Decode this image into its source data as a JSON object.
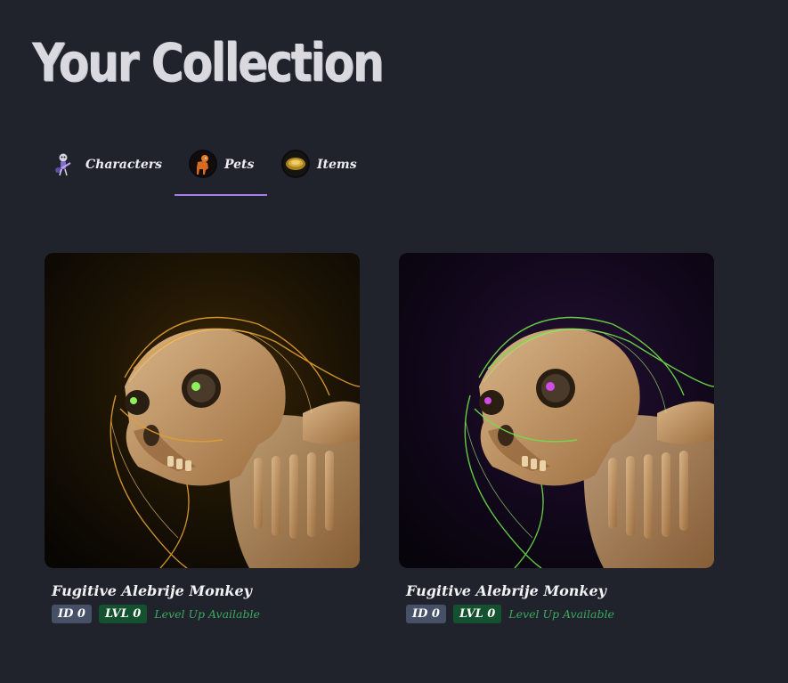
{
  "page": {
    "title": "Your Collection"
  },
  "tabs": [
    {
      "label": "Characters",
      "icon": "skeleton-guitarist-icon",
      "active": false
    },
    {
      "label": "Pets",
      "icon": "monkey-icon",
      "active": true
    },
    {
      "label": "Items",
      "icon": "coin-ring-icon",
      "active": false
    }
  ],
  "cards": [
    {
      "name": "Fugitive Alebrije Monkey",
      "id_badge": "ID 0",
      "lvl_badge": "LVL 0",
      "status": "Level Up Available",
      "glow_color": "#e0a030",
      "eye_color": "#8ef05a",
      "bg_color": "#0d0a04"
    },
    {
      "name": "Fugitive Alebrije Monkey",
      "id_badge": "ID 0",
      "lvl_badge": "LVL 0",
      "status": "Level Up Available",
      "glow_color": "#6ee04a",
      "eye_color": "#d24ae8",
      "bg_color": "#0c0614"
    }
  ],
  "colors": {
    "accent": "#a97de6",
    "background": "#21232c",
    "id_badge": "#465066",
    "lvl_badge": "#14512e",
    "level_up_text": "#3aa860"
  }
}
